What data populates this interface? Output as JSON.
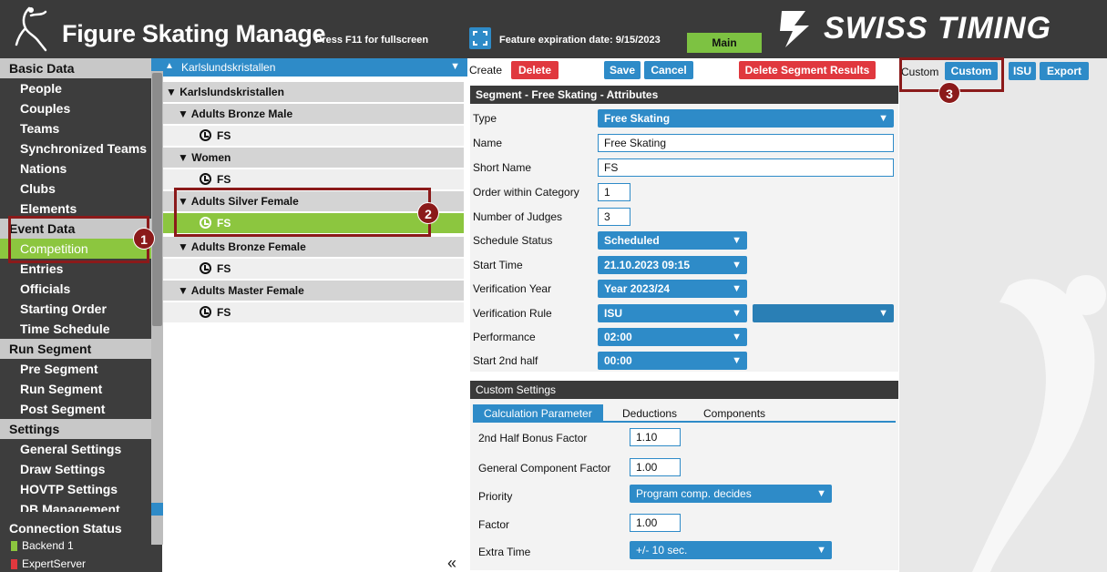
{
  "header": {
    "app_title": "Figure Skating Manage",
    "fullscreen_hint": "Press F11 for fullscreen",
    "expiration": "Feature expiration date: 9/15/2023",
    "main_label": "Main",
    "brand_name": "SWISS TIMING"
  },
  "nav": {
    "basic_data": "Basic Data",
    "people": "People",
    "couples": "Couples",
    "teams": "Teams",
    "synchronized_teams": "Synchronized Teams",
    "nations": "Nations",
    "clubs": "Clubs",
    "elements": "Elements",
    "event_data": "Event Data",
    "competition": "Competition",
    "entries": "Entries",
    "officials": "Officials",
    "starting_order": "Starting Order",
    "time_schedule": "Time Schedule",
    "run_segment_header": "Run Segment",
    "pre_segment": "Pre Segment",
    "run_segment": "Run Segment",
    "post_segment": "Post Segment",
    "settings": "Settings",
    "general_settings": "General Settings",
    "draw_settings": "Draw Settings",
    "hovtp_settings": "HOVTP Settings",
    "db_management": "DB Management"
  },
  "connection": {
    "title": "Connection Status",
    "backend": "Backend 1",
    "expert": "ExpertServer",
    "backend_color": "#8cc63f",
    "expert_color": "#e0383e"
  },
  "tree": {
    "selected": "Karlslundskristallen",
    "root": "Karlslundskristallen",
    "cat1": "Adults Bronze Male",
    "cat2": "Women",
    "cat3": "Adults Silver Female",
    "cat4": "Adults Bronze Female",
    "cat5": "Adults Master Female",
    "segment_label": "FS"
  },
  "toolbar": {
    "create": "Create",
    "delete": "Delete",
    "save": "Save",
    "cancel": "Cancel",
    "delete_results": "Delete Segment Results",
    "custom_label": "Custom",
    "custom_btn": "Custom",
    "isu_btn": "ISU",
    "export_btn": "Export"
  },
  "segment": {
    "header": "Segment - Free Skating - Attributes",
    "type_label": "Type",
    "type_value": "Free Skating",
    "name_label": "Name",
    "name_value": "Free Skating",
    "short_name_label": "Short Name",
    "short_name_value": "FS",
    "order_label": "Order within Category",
    "order_value": "1",
    "judges_label": "Number of Judges",
    "judges_value": "3",
    "schedule_label": "Schedule Status",
    "schedule_value": "Scheduled",
    "start_time_label": "Start Time",
    "start_time_value": "21.10.2023 09:15",
    "verif_year_label": "Verification Year",
    "verif_year_value": "Year 2023/24",
    "verif_rule_label": "Verification Rule",
    "verif_rule_value": "ISU",
    "performance_label": "Performance",
    "performance_value": "02:00",
    "start2_label": "Start 2nd half",
    "start2_value": "00:00"
  },
  "custom": {
    "header": "Custom Settings",
    "tab_calc": "Calculation Parameter",
    "tab_deductions": "Deductions",
    "tab_components": "Components",
    "bonus_label": "2nd Half Bonus Factor",
    "bonus_value": "1.10",
    "gcf_label": "General Component Factor",
    "gcf_value": "1.00",
    "priority_label": "Priority",
    "priority_value": "Program comp. decides",
    "factor_label": "Factor",
    "factor_value": "1.00",
    "extra_label": "Extra Time",
    "extra_value": "+/- 10 sec."
  },
  "callouts": {
    "one": "1",
    "two": "2",
    "three": "3"
  },
  "misc": {
    "collapse": "«"
  }
}
